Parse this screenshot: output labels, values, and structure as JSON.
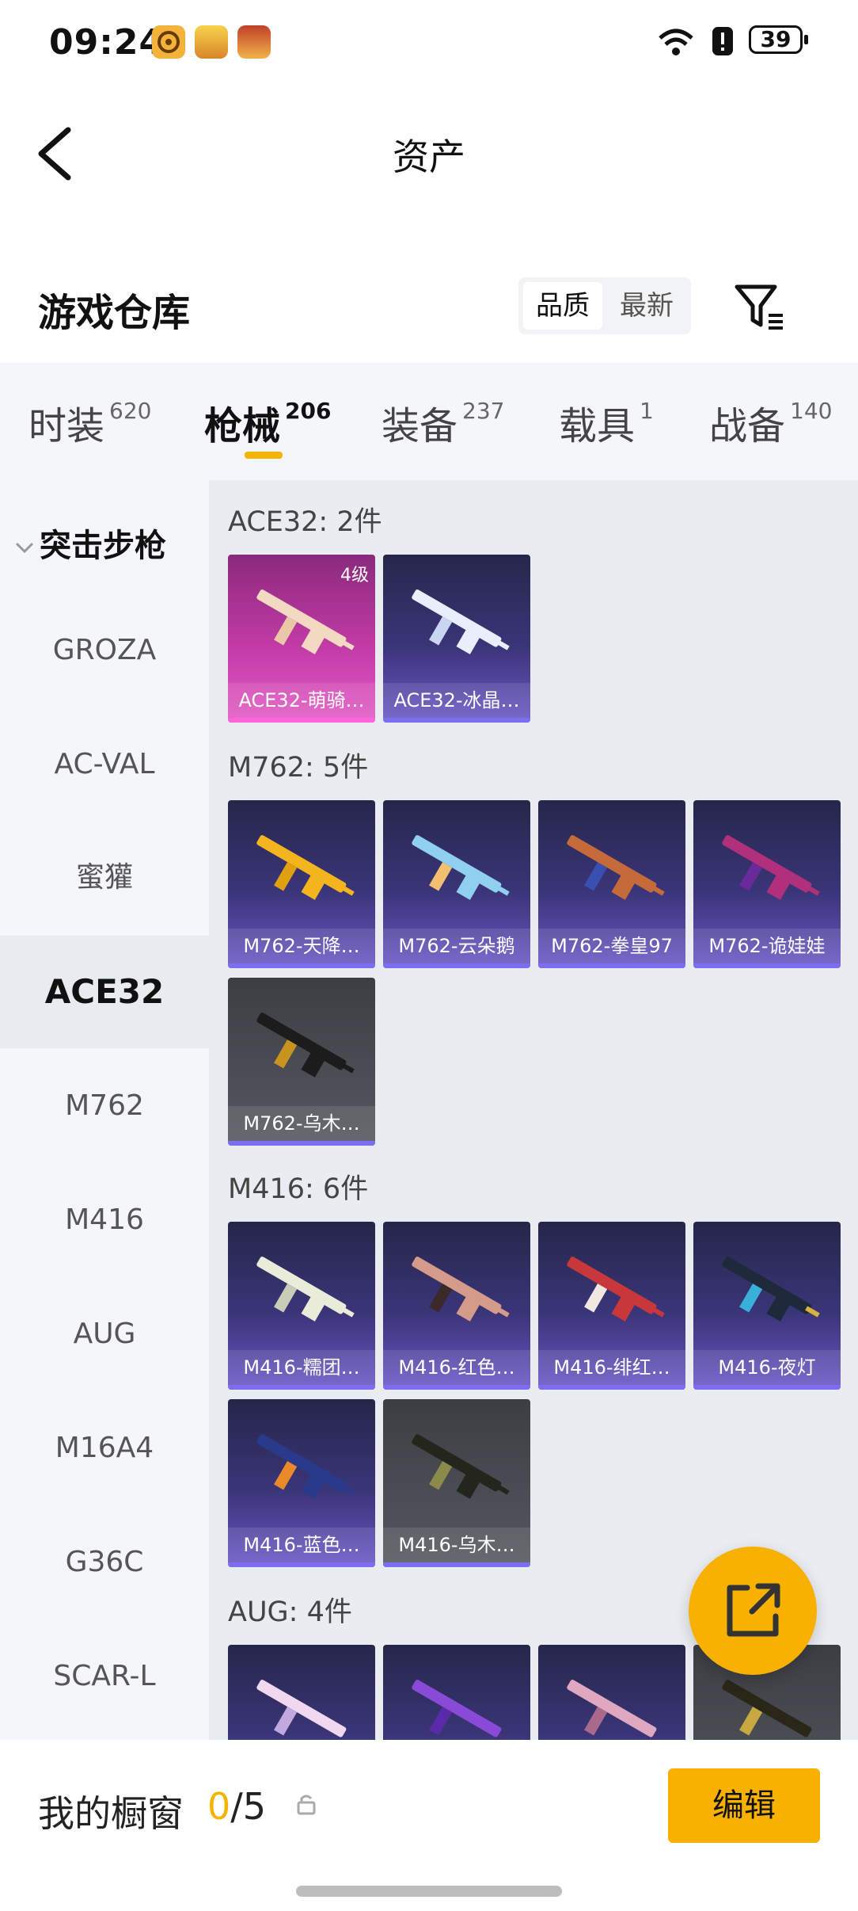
{
  "status_bar": {
    "time": "09:24",
    "battery": "39"
  },
  "header": {
    "title": "资产"
  },
  "warehouse": {
    "title": "游戏仓库",
    "sort_options": [
      "品质",
      "最新"
    ]
  },
  "tabs": [
    {
      "label": "时装",
      "count": "620"
    },
    {
      "label": "枪械",
      "count": "206"
    },
    {
      "label": "装备",
      "count": "237"
    },
    {
      "label": "载具",
      "count": "1"
    },
    {
      "label": "战备",
      "count": "140"
    }
  ],
  "sidebar": {
    "category": "突击步枪",
    "items": [
      "GROZA",
      "AC-VAL",
      "蜜獾",
      "ACE32",
      "M762",
      "M416",
      "AUG",
      "M16A4",
      "G36C",
      "SCAR-L"
    ]
  },
  "groups": [
    {
      "title": "ACE32: 2件",
      "cards": [
        {
          "name": "ACE32-萌骑…",
          "level": "4级"
        },
        {
          "name": "ACE32-冰晶…"
        }
      ]
    },
    {
      "title": "M762: 5件",
      "cards": [
        {
          "name": "M762-天降…"
        },
        {
          "name": "M762-云朵鹅"
        },
        {
          "name": "M762-拳皇97"
        },
        {
          "name": "M762-诡娃娃"
        },
        {
          "name": "M762-乌木…"
        }
      ]
    },
    {
      "title": "M416: 6件",
      "cards": [
        {
          "name": "M416-糯团…"
        },
        {
          "name": "M416-红色…"
        },
        {
          "name": "M416-绯红…"
        },
        {
          "name": "M416-夜灯"
        },
        {
          "name": "M416-蓝色…"
        },
        {
          "name": "M416-乌木…"
        }
      ]
    },
    {
      "title": "AUG: 4件"
    }
  ],
  "bottom": {
    "showcase_label": "我的橱窗",
    "showcase_current": "0",
    "showcase_total": "/5",
    "edit_label": "编辑"
  },
  "colors": {
    "accent": "#f9b100",
    "card_purple": "#3b3579",
    "card_pink": "#c23ba6",
    "card_gray": "#55585f"
  }
}
